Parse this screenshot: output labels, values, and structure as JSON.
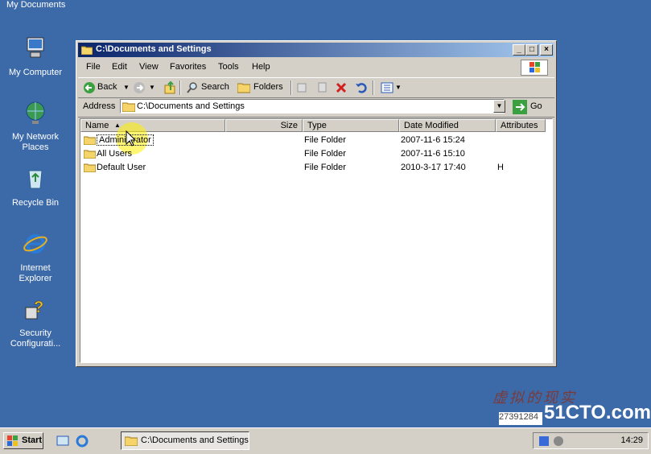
{
  "desktop": {
    "top_label": "My Documents",
    "icons": [
      {
        "label": "My Computer"
      },
      {
        "label": "My Network Places"
      },
      {
        "label": "Recycle Bin"
      },
      {
        "label": "Internet Explorer"
      },
      {
        "label": "Security Configurati..."
      }
    ]
  },
  "window": {
    "title": "C:\\Documents and Settings",
    "buttons": {
      "minimize": "_",
      "maximize": "□",
      "close": "×"
    },
    "menu": [
      "File",
      "Edit",
      "View",
      "Favorites",
      "Tools",
      "Help"
    ],
    "toolbar": {
      "back": "Back",
      "search": "Search",
      "folders": "Folders"
    },
    "address": {
      "label": "Address",
      "value": "C:\\Documents and Settings",
      "go": "Go"
    },
    "columns": [
      "Name",
      "Size",
      "Type",
      "Date Modified",
      "Attributes"
    ],
    "rows": [
      {
        "name": "Administrator",
        "size": "",
        "type": "File Folder",
        "date": "2007-11-6 15:24",
        "attr": ""
      },
      {
        "name": "All Users",
        "size": "",
        "type": "File Folder",
        "date": "2007-11-6 15:10",
        "attr": ""
      },
      {
        "name": "Default User",
        "size": "",
        "type": "File Folder",
        "date": "2010-3-17 17:40",
        "attr": "H"
      }
    ]
  },
  "taskbar": {
    "start": "Start",
    "task": "C:\\Documents and Settings",
    "clock": "14:29"
  },
  "watermark": {
    "text1": "虚拟的现实",
    "text2": "51CTO.com",
    "text3": "27391284"
  },
  "colors": {
    "desktop": "#3c6aa8",
    "title_start": "#0a246a",
    "title_end": "#a6caf0"
  }
}
